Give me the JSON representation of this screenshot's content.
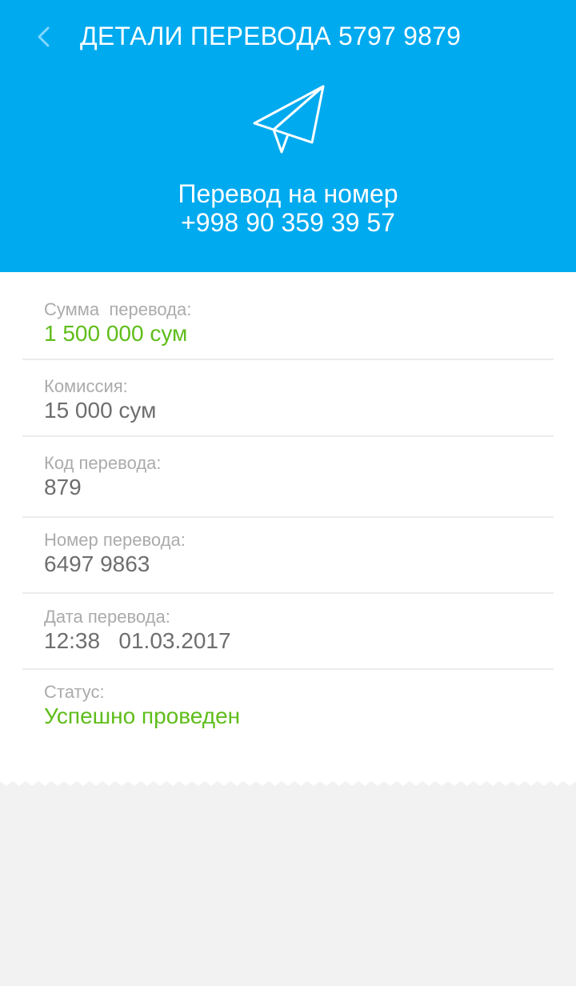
{
  "header": {
    "back_icon": "chevron-left-icon",
    "title": "ДЕТАЛИ ПЕРЕВОДА 5797 9879",
    "icon": "paper-plane-icon",
    "subtitle_line1": "Перевод на номер",
    "subtitle_line2": "+998 90 359 39 57",
    "color": "#00aaef"
  },
  "details": {
    "amount": {
      "label": "Сумма  перевода:",
      "value": "1 500 000 сум"
    },
    "commission": {
      "label": "Комиссия:",
      "value": "15 000 сум"
    },
    "code": {
      "label": "Код перевода:",
      "value": "879"
    },
    "number": {
      "label": "Номер перевода:",
      "value": "6497 9863"
    },
    "date": {
      "label": "Дата перевода:",
      "value": "12:38   01.03.2017"
    },
    "status": {
      "label": "Статус:",
      "value": "Успешно проведен"
    }
  },
  "colors": {
    "accent_green": "#5fbd1a",
    "label_gray": "#ababab",
    "value_gray": "#6e6e6e",
    "page_background": "#f2f2f2"
  }
}
